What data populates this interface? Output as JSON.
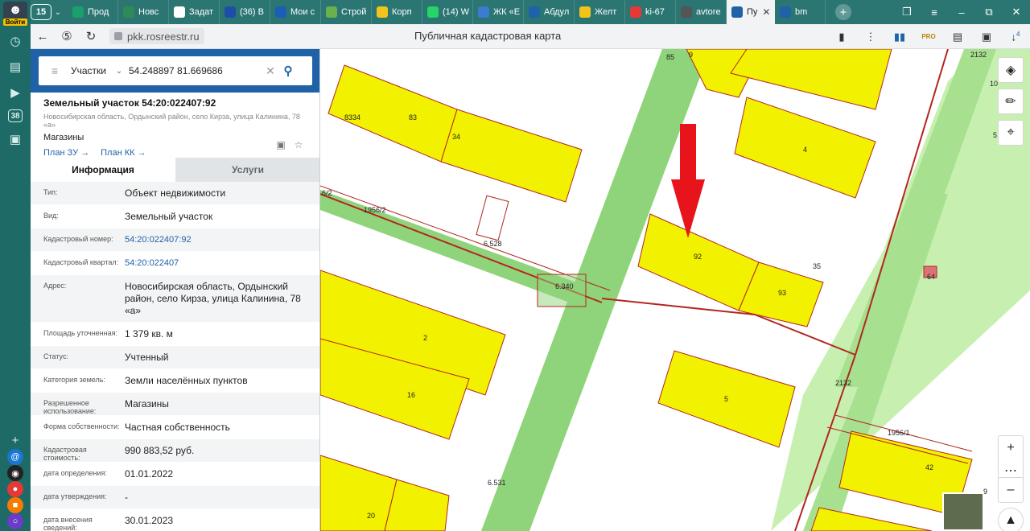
{
  "rail": {
    "login_label": "Войти",
    "badge_number": "38"
  },
  "browser": {
    "tab_count": "15",
    "tabs": [
      {
        "label": "Прод",
        "color": "#1aa06d"
      },
      {
        "label": "Новс",
        "color": "#2e8b57"
      },
      {
        "label": "Задат",
        "color": "#ffffff"
      },
      {
        "label": "(36) В",
        "color": "#1f4ea8"
      },
      {
        "label": "Мои с",
        "color": "#1a5fb4"
      },
      {
        "label": "Строй",
        "color": "#6ab04c"
      },
      {
        "label": "Корп",
        "color": "#f0c419"
      },
      {
        "label": "(14) W",
        "color": "#25d366"
      },
      {
        "label": "ЖК «Е",
        "color": "#3c7bd0"
      },
      {
        "label": "Абдул",
        "color": "#1f62a8"
      },
      {
        "label": "Желт",
        "color": "#f0c419"
      },
      {
        "label": "ki-67",
        "color": "#e53935"
      },
      {
        "label": "avtore",
        "color": "#555555"
      },
      {
        "label": "Пу",
        "color": "#1f62a8"
      },
      {
        "label": "bm",
        "color": "#1f62a8"
      }
    ],
    "active_tab_index": 13,
    "url": "pkk.rosreestr.ru",
    "page_title": "Публичная кадастровая карта",
    "pro_badge": "PRO",
    "downloads_badge": "4"
  },
  "search": {
    "category": "Участки",
    "query": "54.248897 81.669686"
  },
  "object": {
    "title": "Земельный участок 54:20:022407:92",
    "address_line": "Новосибирская область, Ордынский район, село Кирза, улица Калинина, 78 «а»",
    "use": "Магазины",
    "link_plan_zu": "План ЗУ →",
    "link_plan_kk": "План КК →"
  },
  "info_tabs": {
    "info": "Информация",
    "services": "Услуги"
  },
  "rows": [
    {
      "key": "Тип:",
      "value": "Объект недвижимости",
      "link": false
    },
    {
      "key": "Вид:",
      "value": "Земельный участок",
      "link": false
    },
    {
      "key": "Кадастровый номер:",
      "value": "54:20:022407:92",
      "link": true
    },
    {
      "key": "Кадастровый квартал:",
      "value": "54:20:022407",
      "link": true
    },
    {
      "key": "Адрес:",
      "value": "Новосибирская область, Ордынский район, село Кирза, улица Калинина, 78 «а»",
      "link": false
    },
    {
      "key": "Площадь уточненная:",
      "value": "1 379 кв. м",
      "link": false
    },
    {
      "key": "Статус:",
      "value": "Учтенный",
      "link": false
    },
    {
      "key": "Категория земель:",
      "value": "Земли населённых пунктов",
      "link": false
    },
    {
      "key": "Разрешенное использование:",
      "value": "Магазины",
      "link": false
    },
    {
      "key": "Форма собственности:",
      "value": "Частная собственность",
      "link": false
    },
    {
      "key": "Кадастровая стоимость:",
      "value": "990 883,52 руб.",
      "link": false
    },
    {
      "key": "дата определения:",
      "value": "01.01.2022",
      "link": false
    },
    {
      "key": "дата утверждения:",
      "value": "-",
      "link": false
    },
    {
      "key": "дата внесения сведений:",
      "value": "30.01.2023",
      "link": false
    }
  ],
  "map": {
    "labels": [
      "85",
      "9",
      "2132",
      "10",
      "83",
      "34",
      "8334",
      "4",
      "5",
      "6/2",
      "1956/2",
      "6.528",
      "92",
      "35",
      "64",
      "6.340",
      "93",
      "2",
      "2132",
      "16",
      "5",
      "1956/1",
      "42",
      "9",
      "6.531",
      "20"
    ],
    "colors": {
      "plot_fill": "#f2f200",
      "plot_border": "#b3261e",
      "green_zone": "#8fd47a",
      "light_green": "#c7f0b0",
      "arrow": "#e8141c"
    }
  }
}
